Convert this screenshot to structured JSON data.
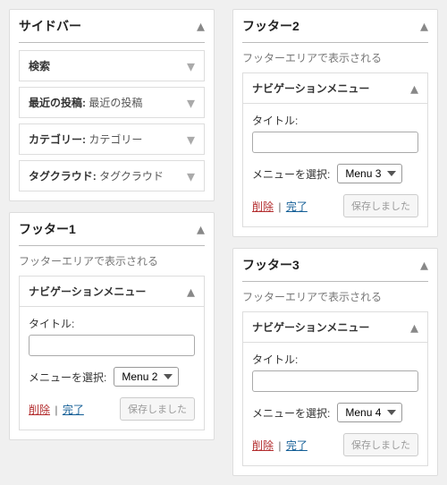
{
  "sidebar": {
    "title": "サイドバー",
    "widgets": [
      {
        "name": "検索",
        "instance": ""
      },
      {
        "name": "最近の投稿",
        "instance": "最近の投稿"
      },
      {
        "name": "カテゴリー",
        "instance": "カテゴリー"
      },
      {
        "name": "タグクラウド",
        "instance": "タグクラウド"
      }
    ]
  },
  "footer1": {
    "title": "フッター1",
    "desc": "フッターエリアで表示される",
    "widget_name": "ナビゲーションメニュー",
    "field_title_label": "タイトル:",
    "menu_select_label": "メニューを選択:",
    "menu_value": "Menu 2",
    "delete": "削除",
    "done": "完了",
    "saved": "保存しました"
  },
  "footer2": {
    "title": "フッター2",
    "desc": "フッターエリアで表示される",
    "widget_name": "ナビゲーションメニュー",
    "field_title_label": "タイトル:",
    "menu_select_label": "メニューを選択:",
    "menu_value": "Menu 3",
    "delete": "削除",
    "done": "完了",
    "saved": "保存しました"
  },
  "footer3": {
    "title": "フッター3",
    "desc": "フッターエリアで表示される",
    "widget_name": "ナビゲーションメニュー",
    "field_title_label": "タイトル:",
    "menu_select_label": "メニューを選択:",
    "menu_value": "Menu 4",
    "delete": "削除",
    "done": "完了",
    "saved": "保存しました"
  }
}
